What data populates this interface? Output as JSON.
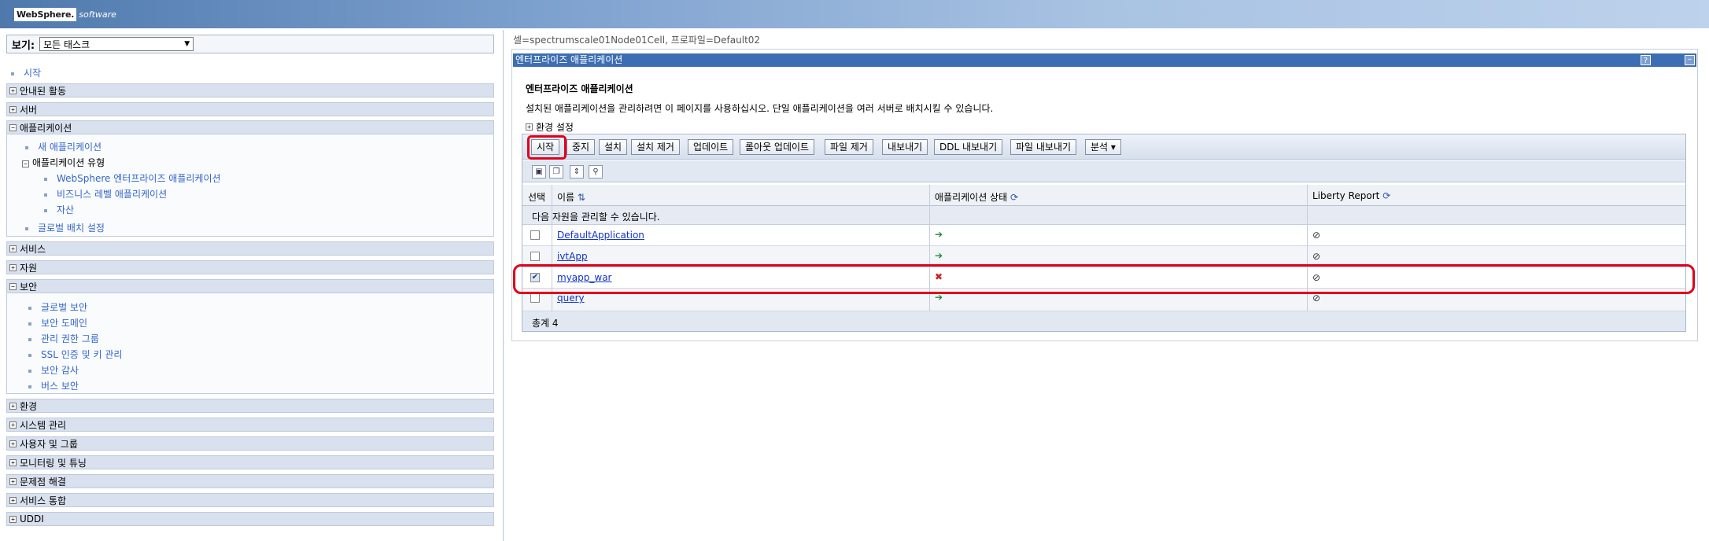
{
  "banner": {
    "logo_box": "WebSphere.",
    "logo_text": "software"
  },
  "left_nav": {
    "view_label": "보기:",
    "view_value": "모든 태스크",
    "start_link": "시작",
    "sections": {
      "guided": "안내된 활동",
      "server": "서버",
      "applications": "애플리케이션",
      "services": "서비스",
      "resources": "자원",
      "security": "보안",
      "environment": "환경",
      "system_admin": "시스템 관리",
      "users_groups": "사용자 및 그룹",
      "monitoring": "모니터링 및 튜닝",
      "troubleshooting": "문제점 해결",
      "service_integration": "서비스 통합",
      "uddi": "UDDI"
    },
    "app_items": {
      "new_app": "새 애플리케이션",
      "app_types": "애플리케이션 유형",
      "websphere_ent": "WebSphere 엔터프라이즈 애플리케이션",
      "business_level": "비즈니스 레벨 애플리케이션",
      "assets": "자산",
      "global_deploy": "글로벌 배치 설정"
    },
    "security_items": {
      "global_security": "글로벌 보안",
      "security_domain": "보안 도메인",
      "admin_groups": "관리 권한 그룹",
      "ssl": "SSL 인증 및 키 관리",
      "security_audit": "보안 감사",
      "bus_security": "버스 보안"
    }
  },
  "main": {
    "breadcrumb": "셀=spectrumscale01Node01Cell, 프로파일=Default02",
    "panel_title": "엔터프라이즈 애플리케이션",
    "help": "?",
    "minimize": "–",
    "heading": "엔터프라이즈 애플리케이션",
    "description": "설치된 애플리케이션을 관리하려면 이 페이지를 사용하십시오. 단일 애플리케이션을 여러 서버로 배치시킬 수 있습니다.",
    "env_settings": "환경 설정",
    "toolbar": {
      "start": "시작",
      "stop": "중지",
      "install": "설치",
      "uninstall": "설치 제거",
      "update": "업데이트",
      "rollout": "롤아웃 업데이트",
      "remove_file": "파일 제거",
      "export": "내보내기",
      "export_ddl": "DDL 내보내기",
      "export_file": "파일 내보내기",
      "analyze": "분석 ▾"
    },
    "columns": {
      "select": "선택",
      "name": "이름",
      "status": "애플리케이션 상태",
      "liberty": "Liberty Report"
    },
    "info": "다음 자원을 관리할 수 있습니다.",
    "rows": [
      {
        "name": "DefaultApplication",
        "checked": "",
        "status_icon": "➔",
        "report_icon": "⊘"
      },
      {
        "name": "ivtApp",
        "checked": "",
        "status_icon": "➔",
        "report_icon": "⊘"
      },
      {
        "name": "myapp_war",
        "checked": "✔",
        "status_icon": "✖",
        "report_icon": "⊘"
      },
      {
        "name": "query",
        "checked": "",
        "status_icon": "➔",
        "report_icon": "⊘"
      }
    ],
    "total": "총계 4"
  }
}
